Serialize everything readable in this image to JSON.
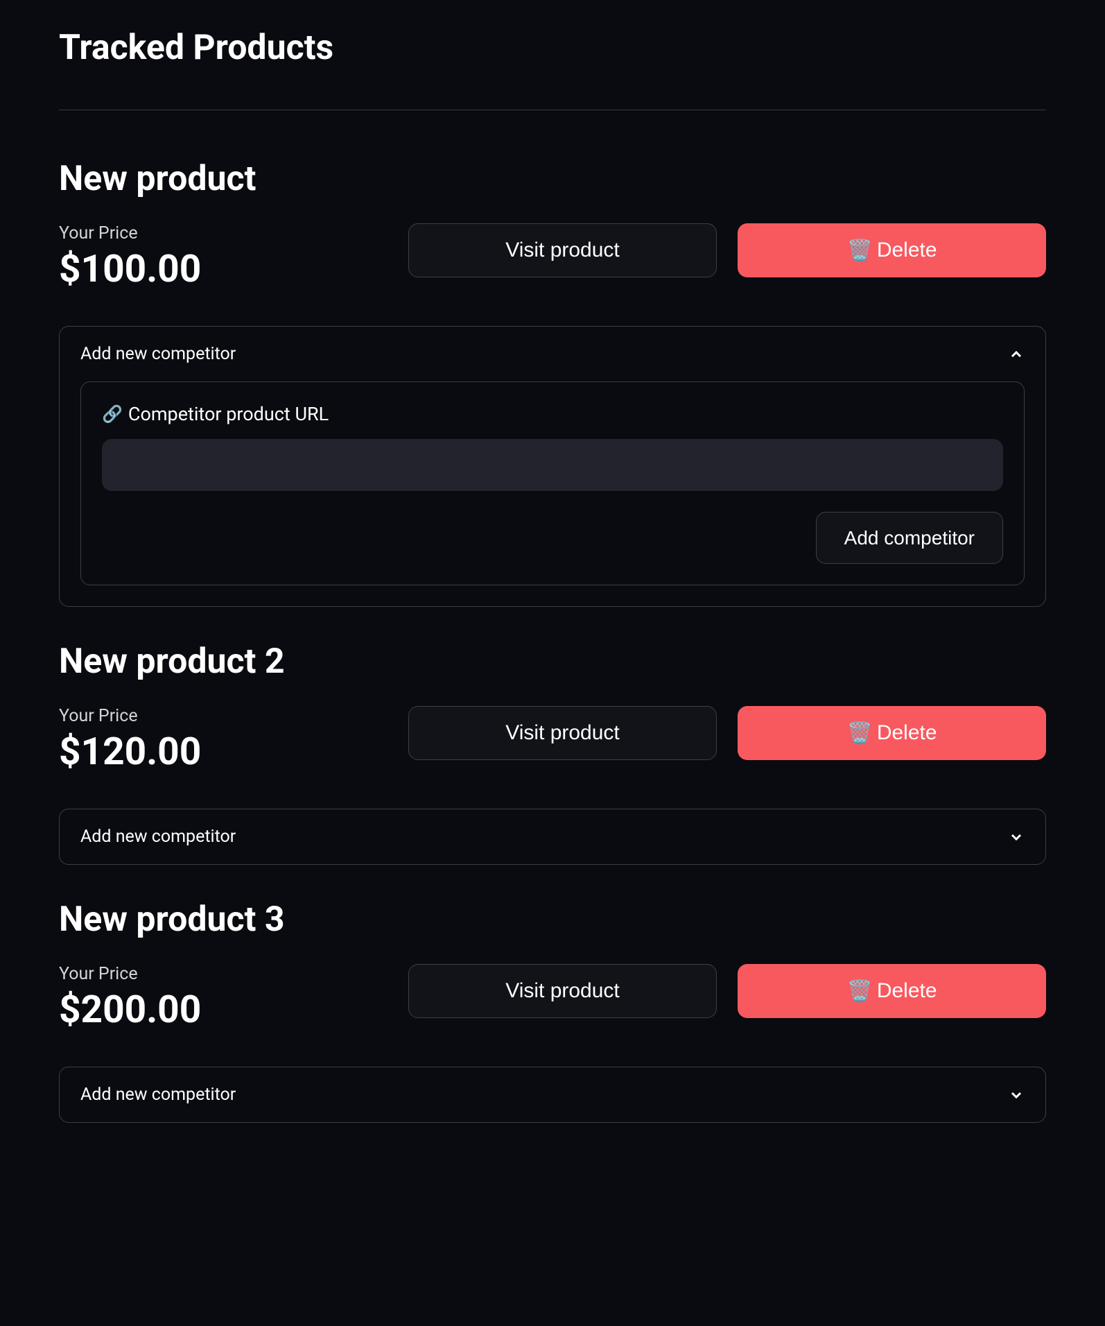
{
  "pageTitle": "Tracked Products",
  "priceLabel": "Your Price",
  "visitLabel": "Visit product",
  "deleteLabel": "Delete",
  "trashEmoji": "🗑️",
  "competitorToggleLabel": "Add new competitor",
  "linkEmoji": "🔗",
  "competitorUrlLabel": "Competitor product URL",
  "addCompetitorLabel": "Add competitor",
  "products": [
    {
      "name": "New product",
      "price": "$100.00",
      "expanded": true
    },
    {
      "name": "New product 2",
      "price": "$120.00",
      "expanded": false
    },
    {
      "name": "New product 3",
      "price": "$200.00",
      "expanded": false
    }
  ]
}
